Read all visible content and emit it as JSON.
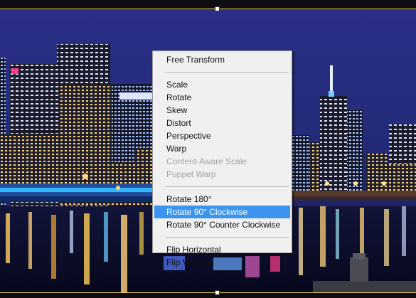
{
  "context_menu": {
    "groups": [
      [
        {
          "label": "Free Transform",
          "enabled": true,
          "highlighted": false
        }
      ],
      [
        {
          "label": "Scale",
          "enabled": true,
          "highlighted": false
        },
        {
          "label": "Rotate",
          "enabled": true,
          "highlighted": false
        },
        {
          "label": "Skew",
          "enabled": true,
          "highlighted": false
        },
        {
          "label": "Distort",
          "enabled": true,
          "highlighted": false
        },
        {
          "label": "Perspective",
          "enabled": true,
          "highlighted": false
        },
        {
          "label": "Warp",
          "enabled": true,
          "highlighted": false
        },
        {
          "label": "Content-Aware Scale",
          "enabled": false,
          "highlighted": false
        },
        {
          "label": "Puppet Warp",
          "enabled": false,
          "highlighted": false
        }
      ],
      [
        {
          "label": "Rotate 180°",
          "enabled": true,
          "highlighted": false
        },
        {
          "label": "Rotate 90° Clockwise",
          "enabled": true,
          "highlighted": true
        },
        {
          "label": "Rotate 90° Counter Clockwise",
          "enabled": true,
          "highlighted": false
        }
      ],
      [
        {
          "label": "Flip Horizontal",
          "enabled": true,
          "highlighted": false
        },
        {
          "label": "Flip Vertical",
          "enabled": true,
          "highlighted": false
        }
      ]
    ]
  },
  "colors": {
    "highlight": "#3b95ee",
    "menu_background": "#f0f0f0",
    "disabled_text": "#a3a3a3",
    "bounding_box_line": "#e8c64a"
  }
}
